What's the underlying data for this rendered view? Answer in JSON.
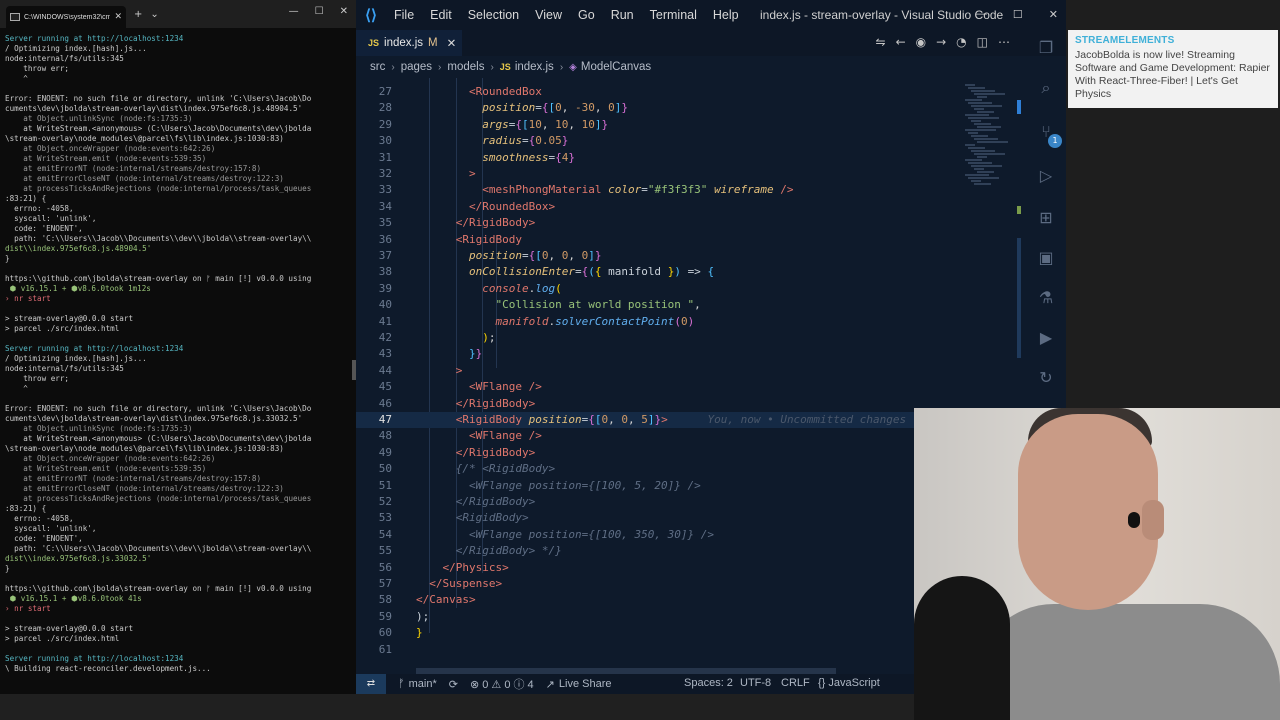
{
  "terminal": {
    "tab_title": "C:\\WINDOWS\\system32\\cmd.",
    "lines": [
      {
        "t": "Server running at http://localhost:1234",
        "c": "cyan"
      },
      {
        "t": "/ Optimizing index.[hash].js...",
        "c": ""
      },
      {
        "t": "node:internal/fs/utils:345",
        "c": ""
      },
      {
        "t": "    throw err;",
        "c": ""
      },
      {
        "t": "    ^",
        "c": ""
      },
      {
        "t": "",
        "c": "blank"
      },
      {
        "t": "Error: ENOENT: no such file or directory, unlink 'C:\\Users\\Jacob\\Do",
        "c": ""
      },
      {
        "t": "cuments\\dev\\jbolda\\stream-overlay\\dist\\index.975ef6c8.js.48904.5'",
        "c": ""
      },
      {
        "t": "    at Object.unlinkSync (node:fs:1735:3)",
        "c": "dim"
      },
      {
        "t": "    at WriteStream.<anonymous> (C:\\Users\\Jacob\\Documents\\dev\\jbolda",
        "c": ""
      },
      {
        "t": "\\stream-overlay\\node_modules\\@parcel\\fs\\lib\\index.js:1030:83)",
        "c": ""
      },
      {
        "t": "    at Object.onceWrapper (node:events:642:26)",
        "c": "dim"
      },
      {
        "t": "    at WriteStream.emit (node:events:539:35)",
        "c": "dim"
      },
      {
        "t": "    at emitErrorNT (node:internal/streams/destroy:157:8)",
        "c": "dim"
      },
      {
        "t": "    at emitErrorCloseNT (node:internal/streams/destroy:122:3)",
        "c": "dim"
      },
      {
        "t": "    at processTicksAndRejections (node:internal/process/task_queues",
        "c": "dim"
      },
      {
        "t": ":83:21) {",
        "c": ""
      },
      {
        "t": "  errno: -4058,",
        "c": ""
      },
      {
        "t": "  syscall: 'unlink',",
        "c": ""
      },
      {
        "t": "  code: 'ENOENT',",
        "c": ""
      },
      {
        "t": "  path: 'C:\\\\Users\\\\Jacob\\\\Documents\\\\dev\\\\jbolda\\\\stream-overlay\\\\",
        "c": ""
      },
      {
        "t": "dist\\\\index.975ef6c8.js.48904.5'",
        "c": "green"
      },
      {
        "t": "}",
        "c": ""
      },
      {
        "t": "",
        "c": "blank"
      },
      {
        "t": "https:\\\\github.com\\jbolda\\stream-overlay on ᚠ main [!] v0.0.0 using",
        "c": ""
      },
      {
        "t": " ⬢ v16.15.1 + ⬢v8.6.0took 1m12s",
        "c": "green"
      },
      {
        "t": "› nr start",
        "c": "red"
      },
      {
        "t": "",
        "c": "blank"
      },
      {
        "t": "> stream-overlay@0.0.0 start",
        "c": ""
      },
      {
        "t": "> parcel ./src/index.html",
        "c": ""
      },
      {
        "t": "",
        "c": "blank"
      },
      {
        "t": "Server running at http://localhost:1234",
        "c": "cyan"
      },
      {
        "t": "/ Optimizing index.[hash].js...",
        "c": ""
      },
      {
        "t": "node:internal/fs/utils:345",
        "c": ""
      },
      {
        "t": "    throw err;",
        "c": ""
      },
      {
        "t": "    ^",
        "c": ""
      },
      {
        "t": "",
        "c": "blank"
      },
      {
        "t": "Error: ENOENT: no such file or directory, unlink 'C:\\Users\\Jacob\\Do",
        "c": ""
      },
      {
        "t": "cuments\\dev\\jbolda\\stream-overlay\\dist\\index.975ef6c8.js.33032.5'",
        "c": ""
      },
      {
        "t": "    at Object.unlinkSync (node:fs:1735:3)",
        "c": "dim"
      },
      {
        "t": "    at WriteStream.<anonymous> (C:\\Users\\Jacob\\Documents\\dev\\jbolda",
        "c": ""
      },
      {
        "t": "\\stream-overlay\\node_modules\\@parcel\\fs\\lib\\index.js:1030:83)",
        "c": ""
      },
      {
        "t": "    at Object.onceWrapper (node:events:642:26)",
        "c": "dim"
      },
      {
        "t": "    at WriteStream.emit (node:events:539:35)",
        "c": "dim"
      },
      {
        "t": "    at emitErrorNT (node:internal/streams/destroy:157:8)",
        "c": "dim"
      },
      {
        "t": "    at emitErrorCloseNT (node:internal/streams/destroy:122:3)",
        "c": "dim"
      },
      {
        "t": "    at processTicksAndRejections (node:internal/process/task_queues",
        "c": "dim"
      },
      {
        "t": ":83:21) {",
        "c": ""
      },
      {
        "t": "  errno: -4058,",
        "c": ""
      },
      {
        "t": "  syscall: 'unlink',",
        "c": ""
      },
      {
        "t": "  code: 'ENOENT',",
        "c": ""
      },
      {
        "t": "  path: 'C:\\\\Users\\\\Jacob\\\\Documents\\\\dev\\\\jbolda\\\\stream-overlay\\\\",
        "c": ""
      },
      {
        "t": "dist\\\\index.975ef6c8.js.33032.5'",
        "c": "green"
      },
      {
        "t": "}",
        "c": ""
      },
      {
        "t": "",
        "c": "blank"
      },
      {
        "t": "https:\\\\github.com\\jbolda\\stream-overlay on ᚠ main [!] v0.0.0 using",
        "c": ""
      },
      {
        "t": " ⬢ v16.15.1 + ⬢v8.6.0took 41s",
        "c": "green"
      },
      {
        "t": "› nr start",
        "c": "red"
      },
      {
        "t": "",
        "c": "blank"
      },
      {
        "t": "> stream-overlay@0.0.0 start",
        "c": ""
      },
      {
        "t": "> parcel ./src/index.html",
        "c": ""
      },
      {
        "t": "",
        "c": "blank"
      },
      {
        "t": "Server running at http://localhost:1234",
        "c": "cyan"
      },
      {
        "t": "\\ Building react-reconciler.development.js...",
        "c": ""
      }
    ]
  },
  "vscode": {
    "menu": [
      "File",
      "Edit",
      "Selection",
      "View",
      "Go",
      "Run",
      "Terminal",
      "Help"
    ],
    "window_title": "index.js - stream-overlay - Visual Studio Code",
    "tab": {
      "badge": "JS",
      "name": "index.js",
      "modified": "M"
    },
    "breadcrumb": [
      "src",
      "pages",
      "models",
      "index.js",
      "ModelCanvas"
    ],
    "code_lines": [
      {
        "n": "27",
        "h": "        <span class='tag'>&lt;RoundedBox</span>"
      },
      {
        "n": "28",
        "h": "          <span class='attr'>position</span><span class='punct'>=</span><span class='br2'>{</span><span class='br3'>[</span><span class='num'>0</span>, <span class='num'>-30</span>, <span class='num'>0</span><span class='br3'>]</span><span class='br2'>}</span>"
      },
      {
        "n": "29",
        "h": "          <span class='attr'>args</span><span class='punct'>=</span><span class='br2'>{</span><span class='br3'>[</span><span class='num'>10</span>, <span class='num'>10</span>, <span class='num'>10</span><span class='br3'>]</span><span class='br2'>}</span>"
      },
      {
        "n": "30",
        "h": "          <span class='attr'>radius</span><span class='punct'>=</span><span class='br2'>{</span><span class='num'>0.05</span><span class='br2'>}</span>"
      },
      {
        "n": "31",
        "h": "          <span class='attr'>smoothness</span><span class='punct'>=</span><span class='br2'>{</span><span class='num'>4</span><span class='br2'>}</span>"
      },
      {
        "n": "32",
        "h": "        <span class='tag'>&gt;</span>"
      },
      {
        "n": "33",
        "h": "          <span class='tag'>&lt;meshPhongMaterial</span> <span class='attr'>color</span><span class='punct'>=</span><span class='str'>\"#f3f3f3\"</span> <span class='attr'>wireframe</span> <span class='tag'>/&gt;</span>"
      },
      {
        "n": "34",
        "h": "        <span class='tag'>&lt;/RoundedBox&gt;</span>"
      },
      {
        "n": "35",
        "h": "      <span class='tag'>&lt;/RigidBody&gt;</span>"
      },
      {
        "n": "36",
        "h": "      <span class='tag'>&lt;RigidBody</span>"
      },
      {
        "n": "37",
        "h": "        <span class='attr'>position</span><span class='punct'>=</span><span class='br2'>{</span><span class='br3'>[</span><span class='num'>0</span>, <span class='num'>0</span>, <span class='num'>0</span><span class='br3'>]</span><span class='br2'>}</span>"
      },
      {
        "n": "38",
        "h": "        <span class='attr'>onCollisionEnter</span><span class='punct'>=</span><span class='br2'>{</span><span class='br3'>(</span><span class='br1'>{</span> <span class='punct'>manifold</span> <span class='br1'>}</span><span class='br3'>)</span> <span class='punct'>=&gt;</span> <span class='br3'>{</span>"
      },
      {
        "n": "39",
        "h": "          <span class='obj'>console</span>.<span class='fn'>log</span><span class='br1'>(</span>"
      },
      {
        "n": "40",
        "h": "            <span class='str'>\"Collision at world position \"</span>,"
      },
      {
        "n": "41",
        "h": "            <span class='obj'>manifold</span>.<span class='fn'>solverContactPoint</span><span class='br2'>(</span><span class='num'>0</span><span class='br2'>)</span>"
      },
      {
        "n": "42",
        "h": "          <span class='br1'>)</span>;"
      },
      {
        "n": "43",
        "h": "        <span class='br3'>}</span><span class='br2'>}</span>"
      },
      {
        "n": "44",
        "h": "      <span class='tag'>&gt;</span>"
      },
      {
        "n": "45",
        "h": "        <span class='tag'>&lt;WFlange</span> <span class='tag'>/&gt;</span>"
      },
      {
        "n": "46",
        "h": "      <span class='tag'>&lt;/RigidBody&gt;</span>"
      },
      {
        "n": "47",
        "h": "      <span class='tag'>&lt;RigidBody</span> <span class='attr'>position</span><span class='punct'>=</span><span class='br2'>{</span><span class='br3'>[</span><span class='num'>0</span>, <span class='num'>0</span>, <span class='num'>5</span><span class='br3'>]</span><span class='br2'>}</span><span class='tag'>&gt;</span>      <span class='blame'>You, now • Uncommitted changes</span>"
      },
      {
        "n": "48",
        "h": "        <span class='tag'>&lt;WFlange</span> <span class='tag'>/&gt;</span>"
      },
      {
        "n": "49",
        "h": "      <span class='tag'>&lt;/RigidBody&gt;</span>"
      },
      {
        "n": "50",
        "h": "      <span class='cmt'>{/* &lt;RigidBody&gt;</span>"
      },
      {
        "n": "51",
        "h": "        <span class='cmt'>&lt;WFlange position={[100, 5, 20]} /&gt;</span>"
      },
      {
        "n": "52",
        "h": "      <span class='cmt'>&lt;/RigidBody&gt;</span>"
      },
      {
        "n": "53",
        "h": "      <span class='cmt'>&lt;RigidBody&gt;</span>"
      },
      {
        "n": "54",
        "h": "        <span class='cmt'>&lt;WFlange position={[100, 350, 30]} /&gt;</span>"
      },
      {
        "n": "55",
        "h": "      <span class='cmt'>&lt;/RigidBody&gt; */}</span>"
      },
      {
        "n": "56",
        "h": "    <span class='tag'>&lt;/Physics&gt;</span>"
      },
      {
        "n": "57",
        "h": "  <span class='tag'>&lt;/Suspense&gt;</span>"
      },
      {
        "n": "58",
        "h": "<span class='tag'>&lt;/Canvas&gt;</span>"
      },
      {
        "n": "59",
        "h": "<span class='punct'>);</span>"
      },
      {
        "n": "60",
        "h": "<span class='br1'>}</span>"
      },
      {
        "n": "61",
        "h": ""
      }
    ],
    "current_line": "47",
    "status": {
      "branch": "main*",
      "problems": "⊗ 0 ⚠ 0 ⓘ 4",
      "live_share": "Live Share",
      "spaces": "Spaces: 2",
      "encoding": "UTF-8",
      "eol": "CRLF",
      "language": "{} JavaScript"
    }
  },
  "notification": {
    "source": "STREAMELEMENTS",
    "text": "JacobBolda is now live! Streaming Software and Game Development: Rapier With React-Three-Fiber! | Let's Get Physics"
  }
}
